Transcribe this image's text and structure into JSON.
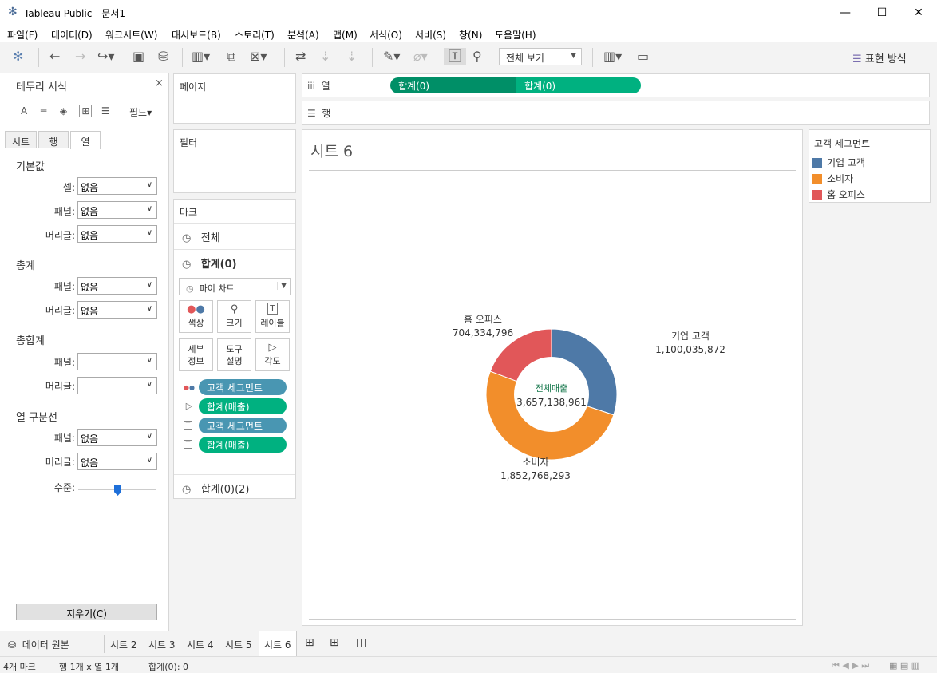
{
  "window": {
    "title": "Tableau Public - 문서1",
    "minimize": "—",
    "maximize": "☐",
    "close": "✕"
  },
  "menu": [
    "파일(F)",
    "데이터(D)",
    "워크시트(W)",
    "대시보드(B)",
    "스토리(T)",
    "분석(A)",
    "맵(M)",
    "서식(O)",
    "서버(S)",
    "창(N)",
    "도움말(H)"
  ],
  "toolbar": {
    "view_select": "전체 보기",
    "show_me": "표현 방식"
  },
  "format_pane": {
    "title": "테두리 서식",
    "field_menu": "필드▾",
    "tabs": [
      "시트",
      "행",
      "열"
    ],
    "active_tab": "열",
    "sections": {
      "default": "기본값",
      "totals": "총계",
      "grand_totals": "총합계",
      "column_divider": "열 구분선"
    },
    "labels": {
      "cell": "셀:",
      "pane": "패널:",
      "header": "머리글:",
      "level": "수준:"
    },
    "values": {
      "none": "없음"
    },
    "clear_button": "지우기(C)"
  },
  "shelves": {
    "pages": "페이지",
    "filters": "필터",
    "columns": "열",
    "rows": "행",
    "column_pills": [
      "합계(0)",
      "합계(0)"
    ]
  },
  "marks": {
    "title": "마크",
    "all": "전체",
    "sum0": "합계(0)",
    "sum0_2": "합계(0)(2)",
    "mark_type": "파이 차트",
    "buttons": {
      "color": "색상",
      "size": "크기",
      "label": "레이블",
      "detail": "세부\n정보",
      "tooltip": "도구\n설명",
      "angle": "각도"
    },
    "fields": [
      "고객 세그먼트",
      "합계(매출)",
      "고객 세그먼트",
      "합계(매출)"
    ]
  },
  "sheet": {
    "title": "시트 6"
  },
  "legend": {
    "title": "고객 세그먼트",
    "items": [
      {
        "label": "기업 고객",
        "color": "#4e79a7"
      },
      {
        "label": "소비자",
        "color": "#f28e2b"
      },
      {
        "label": "홈 오피스",
        "color": "#e15759"
      }
    ]
  },
  "chart_data": {
    "type": "pie",
    "title": "",
    "center_label": "전체매출",
    "center_value": "3,657,138,961",
    "slices": [
      {
        "label": "기업 고객",
        "value": 1100035872,
        "display": "1,100,035,872",
        "color": "#4e79a7"
      },
      {
        "label": "소비자",
        "value": 1852768293,
        "display": "1,852,768,293",
        "color": "#f28e2b"
      },
      {
        "label": "홈 오피스",
        "value": 704334796,
        "display": "704,334,796",
        "color": "#e15759"
      }
    ]
  },
  "sheet_tabs": {
    "data_source": "데이터 원본",
    "tabs": [
      "시트 2",
      "시트 3",
      "시트 4",
      "시트 5",
      "시트 6"
    ],
    "active": "시트 6"
  },
  "status": {
    "marks": "4개 마크",
    "dims": "행 1개  x  열 1개",
    "sum": "합계(0): 0"
  }
}
